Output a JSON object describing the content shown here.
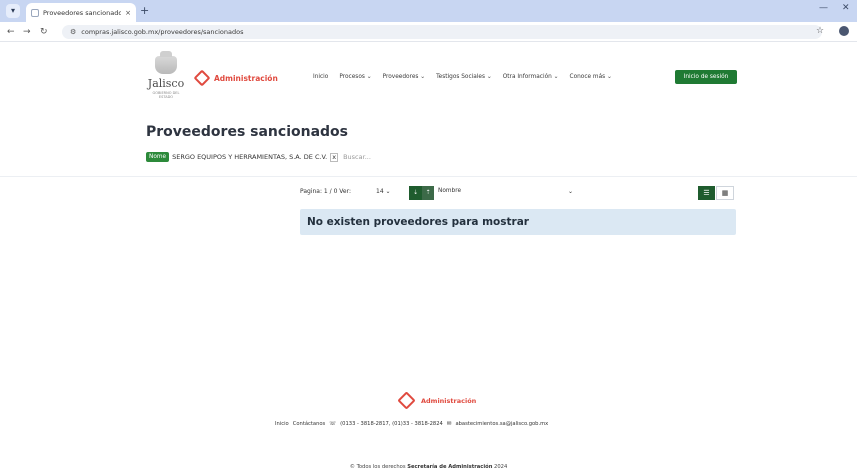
{
  "browser": {
    "tab_title": "Proveedores sancionados | Si",
    "tab_close": "×",
    "new_tab": "+",
    "url": "compras.jalisco.gob.mx/proveedores/sancionados"
  },
  "header": {
    "logo_text": "Jalisco",
    "logo_subtext": "GOBIERNO DEL ESTADO",
    "brand": "Administración",
    "nav": [
      {
        "label": "Inicio"
      },
      {
        "label": "Procesos ⌄"
      },
      {
        "label": "Proveedores ⌄"
      },
      {
        "label": "Testigos Sociales ⌄"
      },
      {
        "label": "Otra Información ⌄"
      },
      {
        "label": "Conoce más ⌄"
      }
    ],
    "login_label": "Inicio de sesión",
    "accent_color": "#1f7a33",
    "brand_color": "#e04a3f"
  },
  "main": {
    "title": "Proveedores sancionados",
    "filter": {
      "label": "Nome",
      "value": "SERGO EQUIPOS Y HERRAMIENTAS, S.A. DE C.V.",
      "remove": "x",
      "search_placeholder": "Buscar..."
    },
    "toolbar": {
      "pagination": "Pagina: 1 / 0 Ver:",
      "per_page": "14 ⌄",
      "sort_asc": "⇣",
      "sort_desc": "⇡",
      "sort_field": "Nombre",
      "sort_caret": "⌄"
    },
    "empty_message": "No existen proveedores para mostrar"
  },
  "footer": {
    "brand": "Administración",
    "links": {
      "inicio": "Inicio",
      "contact": "Contáctanos",
      "phone": "(0133 - 3818-2817, (01)33 - 3818-2824",
      "email": "abastecimientos.sa@jalisco.gob.mx"
    },
    "copyright_prefix": "© Todos los derechos",
    "copyright_org": "Secretaría de Administración",
    "copyright_year": "2024"
  }
}
